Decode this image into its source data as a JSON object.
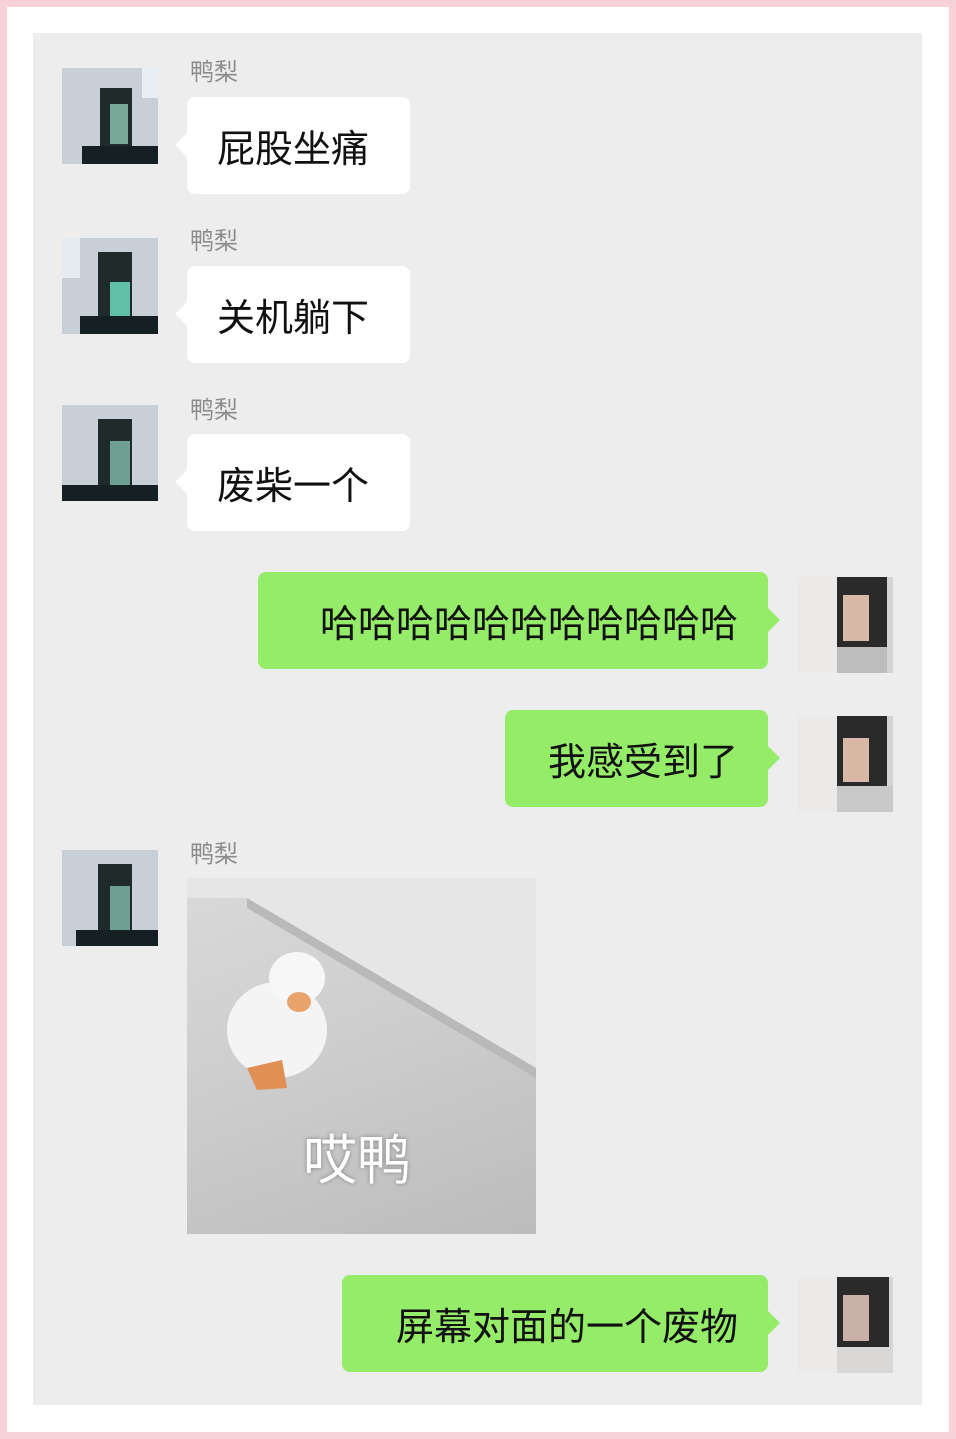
{
  "chat": {
    "messages": [
      {
        "side": "in",
        "sender": "鸭梨",
        "text": "屁股坐痛"
      },
      {
        "side": "in",
        "sender": "鸭梨",
        "text": "关机躺下"
      },
      {
        "side": "in",
        "sender": "鸭梨",
        "text": "废柴一个"
      },
      {
        "side": "out",
        "text": "哈哈哈哈哈哈哈哈哈哈哈"
      },
      {
        "side": "out",
        "text": "我感受到了"
      },
      {
        "side": "in",
        "sender": "鸭梨",
        "sticker_caption": "哎鸭",
        "sticker_icon": "duck-sticker"
      },
      {
        "side": "out",
        "text": "屏幕对面的一个废物"
      }
    ]
  },
  "colors": {
    "chat_background": "#ededed",
    "incoming_bubble": "#ffffff",
    "outgoing_bubble": "#95ec69",
    "sender_name": "#8c8c8c",
    "page_border": "#f6d3d6"
  }
}
